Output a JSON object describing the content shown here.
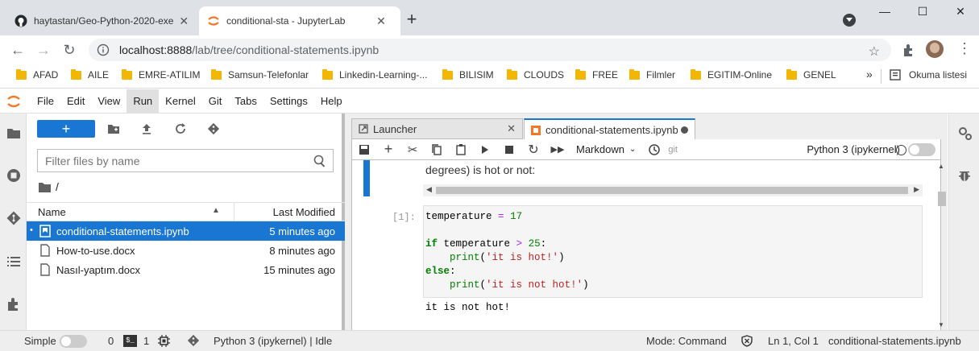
{
  "browser": {
    "tabs": [
      {
        "title": "haytastan/Geo-Python-2020-exer",
        "icon": "github-icon"
      },
      {
        "title": "conditional-sta - JupyterLab",
        "icon": "jupyter-icon"
      }
    ],
    "url_host": "localhost:8888",
    "url_path": "/lab/tree/conditional-statements.ipynb",
    "bookmarks": [
      "AFAD",
      "AILE",
      "EMRE-ATILIM",
      "Samsun-Telefonlar",
      "Linkedin-Learning-...",
      "BILISIM",
      "CLOUDS",
      "FREE",
      "Filmler",
      "EGITIM-Online",
      "GENEL"
    ],
    "more_bookmarks": "»",
    "reading_list": "Okuma listesi"
  },
  "jupyter": {
    "menu": [
      "File",
      "Edit",
      "View",
      "Run",
      "Kernel",
      "Git",
      "Tabs",
      "Settings",
      "Help"
    ],
    "active_menu": "Run",
    "filebrowser": {
      "new_button": "+",
      "filter_placeholder": "Filter files by name",
      "path": "/",
      "col_name": "Name",
      "col_modified": "Last Modified",
      "files": [
        {
          "name": "conditional-statements.ipynb",
          "modified": "5 minutes ago",
          "selected": true,
          "icon": "notebook-icon",
          "running": "•"
        },
        {
          "name": "How-to-use.docx",
          "modified": "8 minutes ago",
          "selected": false,
          "icon": "file-icon",
          "running": ""
        },
        {
          "name": "Nasıl-yaptım.docx",
          "modified": "15 minutes ago",
          "selected": false,
          "icon": "file-icon",
          "running": ""
        }
      ]
    },
    "tabs": [
      {
        "title": "Launcher"
      },
      {
        "title": "conditional-statements.ipynb"
      }
    ],
    "toolbar": {
      "cell_type": "Markdown",
      "git": "git",
      "kernel": "Python 3 (ipykernel)"
    },
    "markdown_text": "degrees) is hot or not:",
    "cell_prompt": "[1]:",
    "code": {
      "l1_var": "temperature",
      "l1_op": "=",
      "l1_num": "17",
      "l3_kw": "if",
      "l3_var": "temperature",
      "l3_op": ">",
      "l3_num": "25",
      "l3_colon": ":",
      "l4_fn": "print",
      "l4_str": "'it is hot!'",
      "l5_kw": "else",
      "l5_colon": ":",
      "l6_fn": "print",
      "l6_str": "'it is not hot!'"
    },
    "output": "it is not hot!",
    "status": {
      "mode_label": "Simple",
      "terminals": "0",
      "kernels": "1",
      "kernel_status": "Python 3 (ipykernel) | Idle",
      "mode": "Mode: Command",
      "position": "Ln 1, Col 1",
      "filename": "conditional-statements.ipynb"
    }
  }
}
